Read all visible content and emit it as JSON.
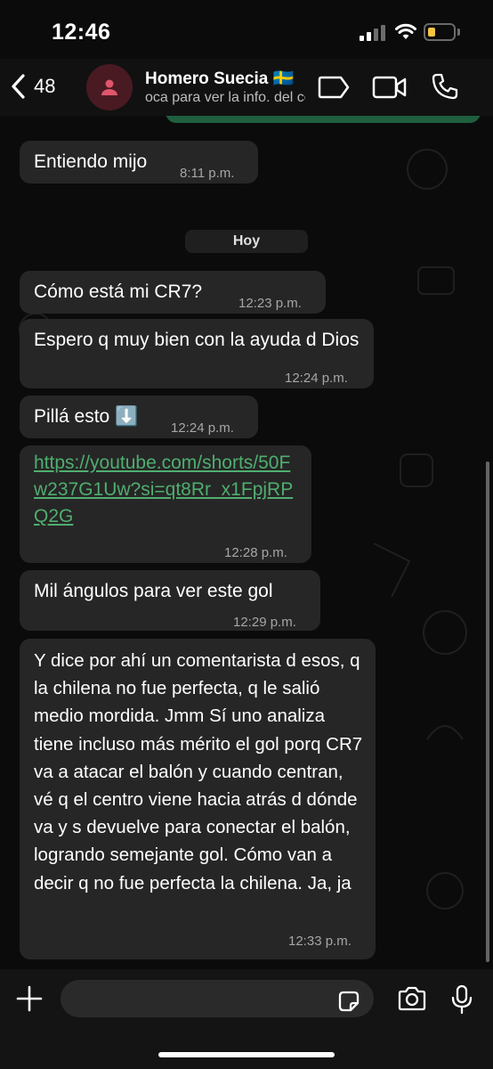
{
  "status": {
    "time": "12:46"
  },
  "header": {
    "back_count": "48",
    "contact_name": "Homero Suecia 🇸🇪",
    "contact_sub": "oca para ver la info. del contacto"
  },
  "chat": {
    "date_separator": "Hoy",
    "messages": [
      {
        "text": "Entiendo mijo",
        "time": "8:11 p.m."
      },
      {
        "text": "Cómo está mi CR7?",
        "time": "12:23 p.m."
      },
      {
        "text": "Espero q muy bien con la ayuda d Dios",
        "time": "12:24 p.m."
      },
      {
        "text": "Pillá esto ⬇️",
        "time": "12:24 p.m."
      },
      {
        "link": "https://youtube.com/shorts/50Fw237G1Uw?si=qt8Rr_x1FpjRPQ2G",
        "time": "12:28 p.m."
      },
      {
        "text": "Mil ángulos para ver este gol",
        "time": "12:29 p.m."
      },
      {
        "text": "Y dice por ahí un comentarista d esos, q la chilena no fue perfecta, q le salió medio mordida. Jmm Sí uno analiza tiene incluso más mérito el gol porq CR7 va a atacar el balón y cuando centran, vé q el centro viene hacia atrás d dónde va y s devuelve para conectar el balón, logrando semejante gol. Cómo van a decir q no fue perfecta la chilena. Ja, ja",
        "time": "12:33 p.m."
      }
    ]
  },
  "composer": {
    "value": ""
  },
  "colors": {
    "link": "#4fae6f",
    "incoming_bubble": "#262626",
    "outgoing_bubble": "#1f5f3f",
    "battery": "#f5c542"
  },
  "icons": [
    "chevron-left-icon",
    "person-icon",
    "label-icon",
    "video-icon",
    "phone-icon",
    "plus-icon",
    "sticker-icon",
    "camera-icon",
    "mic-icon"
  ]
}
